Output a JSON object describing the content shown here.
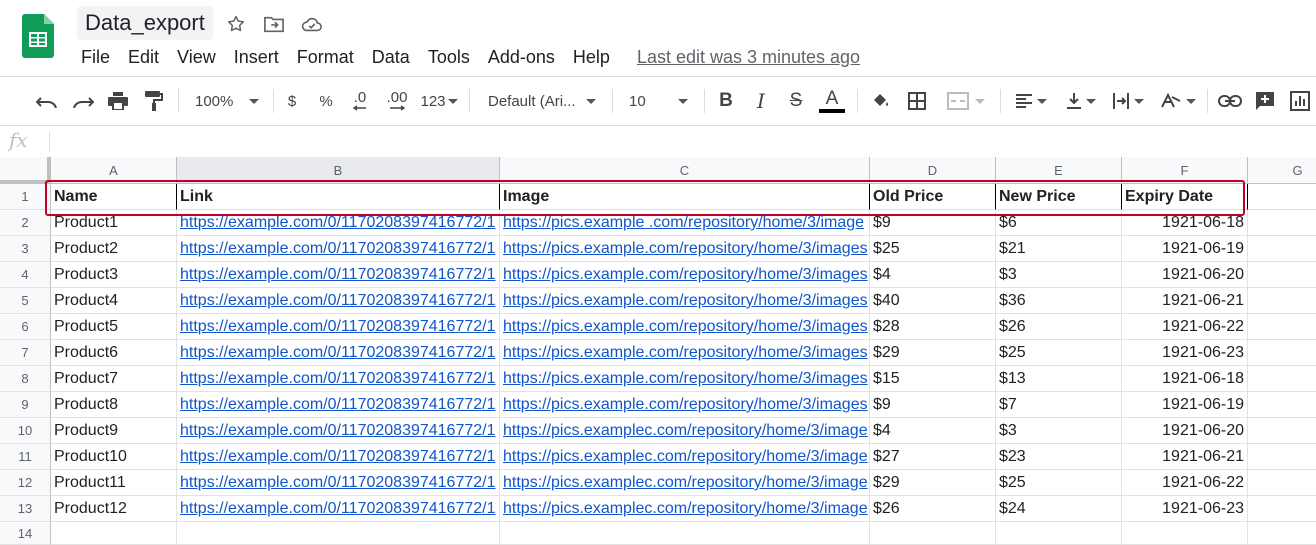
{
  "doc": {
    "title": "Data_export"
  },
  "menu": {
    "items": [
      "File",
      "Edit",
      "View",
      "Insert",
      "Format",
      "Data",
      "Tools",
      "Add-ons",
      "Help"
    ],
    "last_edit": "Last edit was 3 minutes ago"
  },
  "toolbar": {
    "zoom": "100%",
    "currency": "$",
    "percent": "%",
    "dec_decrease": ".0",
    "dec_increase": ".00",
    "more_formats": "123",
    "font": "Default (Ari...",
    "font_size": "10",
    "bold": "B",
    "italic": "I",
    "strike": "S",
    "text_color": "A"
  },
  "formula_bar": {
    "fx": "fx",
    "value": ""
  },
  "sheet": {
    "columns": [
      "A",
      "B",
      "C",
      "D",
      "E",
      "F",
      "G"
    ],
    "row_numbers": [
      "1",
      "2",
      "3",
      "4",
      "5",
      "6",
      "7",
      "8",
      "9",
      "10",
      "11",
      "12",
      "13",
      "14"
    ],
    "headers": [
      "Name",
      "Link",
      "Image",
      "Old Price",
      "New Price",
      "Expiry Date"
    ],
    "rows": [
      [
        "Product1",
        "https://example.com/0/1170208397416772/1",
        "https://pics.example .com/repository/home/3/image",
        "$9",
        "$6",
        "1921-06-18"
      ],
      [
        "Product2",
        "https://example.com/0/1170208397416772/1",
        "https://pics.example.com/repository/home/3/images",
        "$25",
        "$21",
        "1921-06-19"
      ],
      [
        "Product3",
        "https://example.com/0/1170208397416772/1",
        "https://pics.example.com/repository/home/3/images",
        "$4",
        "$3",
        "1921-06-20"
      ],
      [
        "Product4",
        "https://example.com/0/1170208397416772/1",
        "https://pics.example.com/repository/home/3/images",
        "$40",
        "$36",
        "1921-06-21"
      ],
      [
        "Product5",
        "https://example.com/0/1170208397416772/1",
        "https://pics.example.com/repository/home/3/images",
        "$28",
        "$26",
        "1921-06-22"
      ],
      [
        "Product6",
        "https://example.com/0/1170208397416772/1",
        "https://pics.example.com/repository/home/3/images",
        "$29",
        "$25",
        "1921-06-23"
      ],
      [
        "Product7",
        "https://example.com/0/1170208397416772/1",
        "https://pics.example.com/repository/home/3/images",
        "$15",
        "$13",
        "1921-06-18"
      ],
      [
        "Product8",
        "https://example.com/0/1170208397416772/1",
        "https://pics.example.com/repository/home/3/images",
        "$9",
        "$7",
        "1921-06-19"
      ],
      [
        "Product9",
        "https://example.com/0/1170208397416772/1",
        "https://pics.examplec.com/repository/home/3/image",
        "$4",
        "$3",
        "1921-06-20"
      ],
      [
        "Product10",
        "https://example.com/0/1170208397416772/1",
        "https://pics.examplec.com/repository/home/3/image",
        "$27",
        "$23",
        "1921-06-21"
      ],
      [
        "Product11",
        "https://example.com/0/1170208397416772/1",
        "https://pics.examplec.com/repository/home/3/image",
        "$29",
        "$25",
        "1921-06-22"
      ],
      [
        "Product12",
        "https://example.com/0/1170208397416772/1",
        "https://pics.examplec.com/repository/home/3/image",
        "$26",
        "$24",
        "1921-06-23"
      ]
    ]
  },
  "colors": {
    "brand": "#0f9d58",
    "link": "#1155cc",
    "highlight": "#c00024"
  }
}
